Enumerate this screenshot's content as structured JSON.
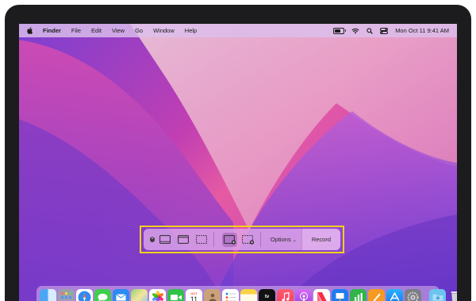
{
  "menubar": {
    "app_name": "Finder",
    "menus": [
      "File",
      "Edit",
      "View",
      "Go",
      "Window",
      "Help"
    ],
    "clock": "Mon Oct 11  9:41 AM",
    "status_icons": [
      "battery-icon",
      "wifi-icon",
      "search-icon",
      "control-center-icon"
    ]
  },
  "toolbar": {
    "buttons": [
      "close-icon",
      "capture-entire-screen-icon",
      "capture-window-icon",
      "capture-selection-icon",
      "record-entire-screen-icon",
      "record-selection-icon"
    ],
    "options_label": "Options",
    "record_label": "Record"
  },
  "dock": {
    "apps": [
      "Finder",
      "Launchpad",
      "Safari",
      "Messages",
      "Mail",
      "Maps",
      "Photos",
      "FaceTime",
      "Calendar",
      "Contacts",
      "Reminders",
      "Notes",
      "TV",
      "Music",
      "Podcasts",
      "News",
      "Keynote",
      "Numbers",
      "Pages",
      "App Store",
      "System Preferences"
    ],
    "calendar_day": "11",
    "calendar_month": "OCT",
    "trailing": [
      "Downloads",
      "Trash"
    ]
  },
  "colors": {
    "highlight": "#f0d21a",
    "wallpaper_purple": "#7b3fd1",
    "wallpaper_pink": "#e65aa3"
  }
}
